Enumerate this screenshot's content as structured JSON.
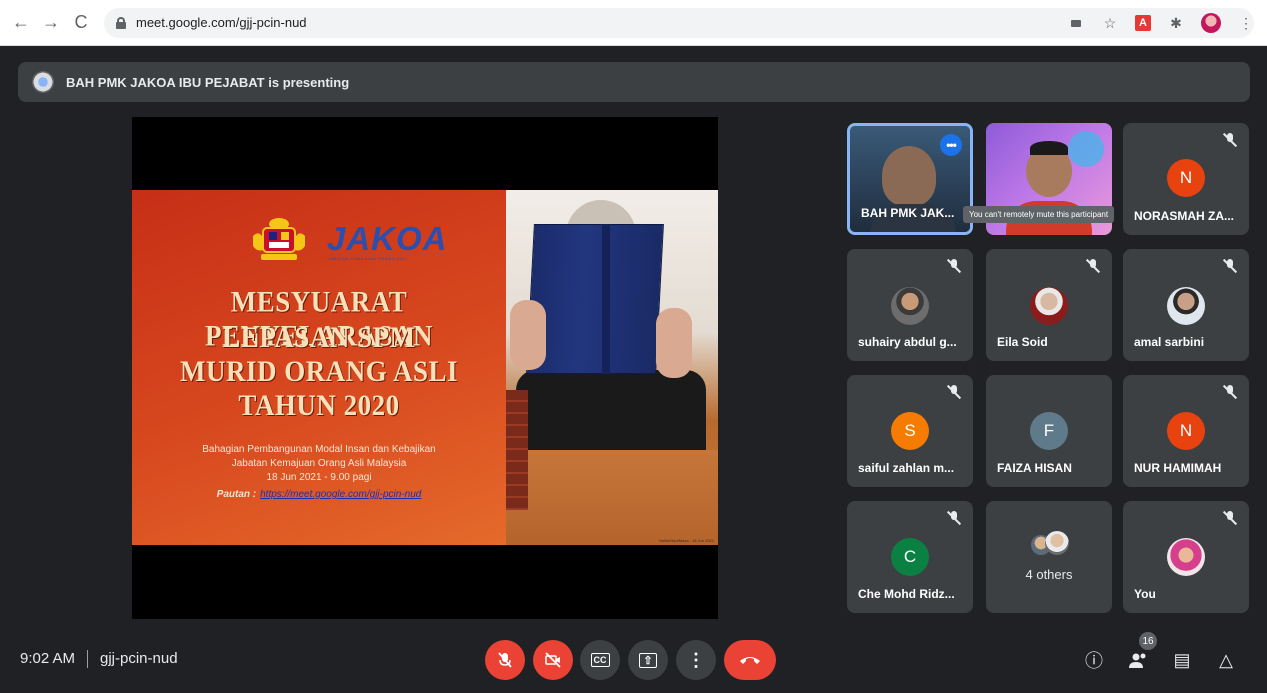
{
  "browser": {
    "url": "meet.google.com/gjj-pcin-nud",
    "nav": {
      "back": "←",
      "forward": "→",
      "reload": "C"
    },
    "ext_pdf": "A",
    "ext_puzzle": "✱",
    "star": "☆",
    "menu": "⋮"
  },
  "banner": {
    "text": "BAH PMK JAKOA IBU PEJABAT is presenting"
  },
  "slide": {
    "logo_text": "JAKOA",
    "logo_sub": "JABATAN KEMAJUAN ORANG ASLI",
    "title_lines": [
      "MESYUARAT PENYELARASAN",
      "LEPASAN SPM",
      "MURID ORANG ASLI",
      "TAHUN 2020"
    ],
    "info_lines": [
      "Bahagian Pembangunan Modal Insan dan Kebajikan",
      "Jabatan Kemajuan Orang Asli Malaysia",
      "18 Jun 2021  -  9.00 pagi"
    ],
    "link_label": "Pautan :",
    "link_url": "https://meet.google.com/gjj-pcin-nud",
    "caption": "Tarikh/Hari/Masa : 18 Jun 2021"
  },
  "tiles": [
    {
      "name": "BAH PMK JAK...",
      "more": "•••"
    },
    {
      "name": ""
    },
    {
      "name": "NORASMAH ZA...",
      "letter": "N",
      "color": "#e8430f"
    },
    {
      "name": "suhairy abdul g..."
    },
    {
      "name": "Eila Soid"
    },
    {
      "name": "amal sarbini"
    },
    {
      "name": "saiful zahlan m...",
      "letter": "S",
      "color": "#f57c00"
    },
    {
      "name": "FAIZA HISAN",
      "letter": "F",
      "color": "#5f7a8a"
    },
    {
      "name": "NUR HAMIMAH",
      "letter": "N",
      "color": "#e8430f"
    },
    {
      "name": "Che Mohd Ridz...",
      "letter": "C",
      "color": "#0b8043"
    },
    {
      "label": "4 others"
    },
    {
      "name": "You"
    }
  ],
  "tooltip": "You can't remotely mute this participant",
  "bottom": {
    "time": "9:02 AM",
    "meeting_code": "gjj-pcin-nud",
    "controls": {
      "cc": "CC",
      "present": "⇧",
      "more": "⋮"
    },
    "right": {
      "info": "ⓘ",
      "people_count": "16",
      "chat": "▤",
      "activities": "△"
    }
  }
}
